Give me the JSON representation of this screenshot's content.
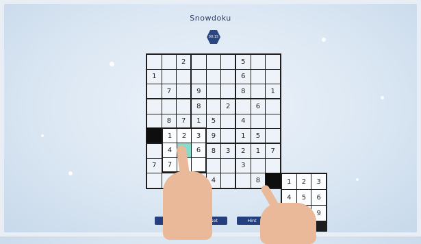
{
  "title": "Snowdoku",
  "timer": "00:15",
  "board": [
    [
      "",
      "",
      "2",
      "",
      "",
      "",
      "5",
      "",
      ""
    ],
    [
      "1",
      "",
      "",
      "",
      "",
      "",
      "6",
      "",
      ""
    ],
    [
      "",
      "7",
      "",
      "9",
      "",
      "",
      "8",
      "",
      "1"
    ],
    [
      "",
      "",
      "",
      "8",
      "",
      "2",
      "",
      "6",
      ""
    ],
    [
      "",
      "8",
      "7",
      "1",
      "5",
      "",
      "4",
      "",
      ""
    ],
    [
      "",
      "",
      "",
      "",
      "9",
      "",
      "1",
      "5",
      ""
    ],
    [
      "",
      "",
      "",
      "",
      "8",
      "3",
      "2",
      "1",
      "7"
    ],
    [
      "7",
      "",
      "",
      "",
      "",
      "",
      "3",
      "",
      ""
    ],
    [
      "",
      "",
      "",
      "",
      "4",
      "",
      "",
      "8",
      ""
    ]
  ],
  "left_pad": {
    "numbers": [
      "1",
      "2",
      "3",
      "4",
      "5",
      "6",
      "7",
      "",
      ""
    ],
    "highlighted": "5"
  },
  "right_pad": {
    "numbers": [
      "1",
      "2",
      "3",
      "4",
      "5",
      "6",
      "",
      "",
      "9"
    ]
  },
  "buttons": {
    "back": "Back",
    "reset": "Reset",
    "hint": "Hint"
  }
}
